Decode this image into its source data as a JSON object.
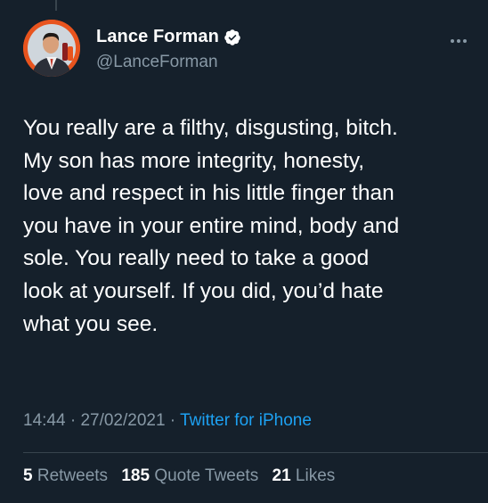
{
  "author": {
    "display_name": "Lance Forman",
    "handle": "@LanceForman",
    "verified": true
  },
  "tweet": {
    "lines": [
      "You really are a filthy, disgusting, bitch.",
      "My son has more integrity, honesty,",
      "love and respect in his little finger than",
      "you have in your entire mind, body and",
      "sole.  You really need to take a good",
      "look at yourself. If you did, you’d hate",
      "what you see."
    ]
  },
  "meta": {
    "time": "14:44",
    "separator": " · ",
    "date": "27/02/2021",
    "source": "Twitter for iPhone"
  },
  "stats": {
    "retweets_count": "5",
    "retweets_label": "Retweets",
    "quote_tweets_count": "185",
    "quote_tweets_label": "Quote Tweets",
    "likes_count": "21",
    "likes_label": "Likes"
  },
  "colors": {
    "background": "#15202b",
    "text_primary": "#ffffff",
    "text_secondary": "#8899a6",
    "link": "#1da1f2",
    "avatar_ring": "#e8541e"
  },
  "icons": {
    "verified": "verified-badge-icon",
    "more": "more-options-icon"
  }
}
